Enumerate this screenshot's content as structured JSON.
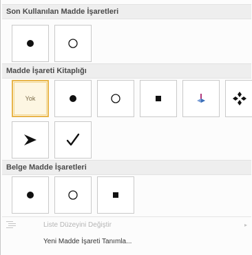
{
  "recent_section": {
    "title": "Son Kullanılan Madde İşaretleri",
    "bullets": [
      "filled-circle",
      "hollow-circle"
    ]
  },
  "library_section": {
    "title": "Madde İşareti Kitaplığı",
    "none_label": "Yok",
    "bullets": [
      "none",
      "filled-circle",
      "hollow-circle",
      "filled-square",
      "picture-bullet",
      "four-diamonds",
      "arrowhead",
      "checkmark"
    ],
    "selected": "none"
  },
  "document_section": {
    "title": "Belge Madde İşaretleri",
    "bullets": [
      "filled-circle",
      "hollow-circle",
      "filled-square"
    ]
  },
  "menu_items": {
    "change_list_level": "Liste Düzeyini Değiştir",
    "define_new_bullet": "Yeni Madde İşareti Tanımla..."
  },
  "colors": {
    "selection_border": "#e8b54a",
    "selection_fill": "#fdf6e2",
    "picture_bullet_accent": "#b0367a"
  }
}
